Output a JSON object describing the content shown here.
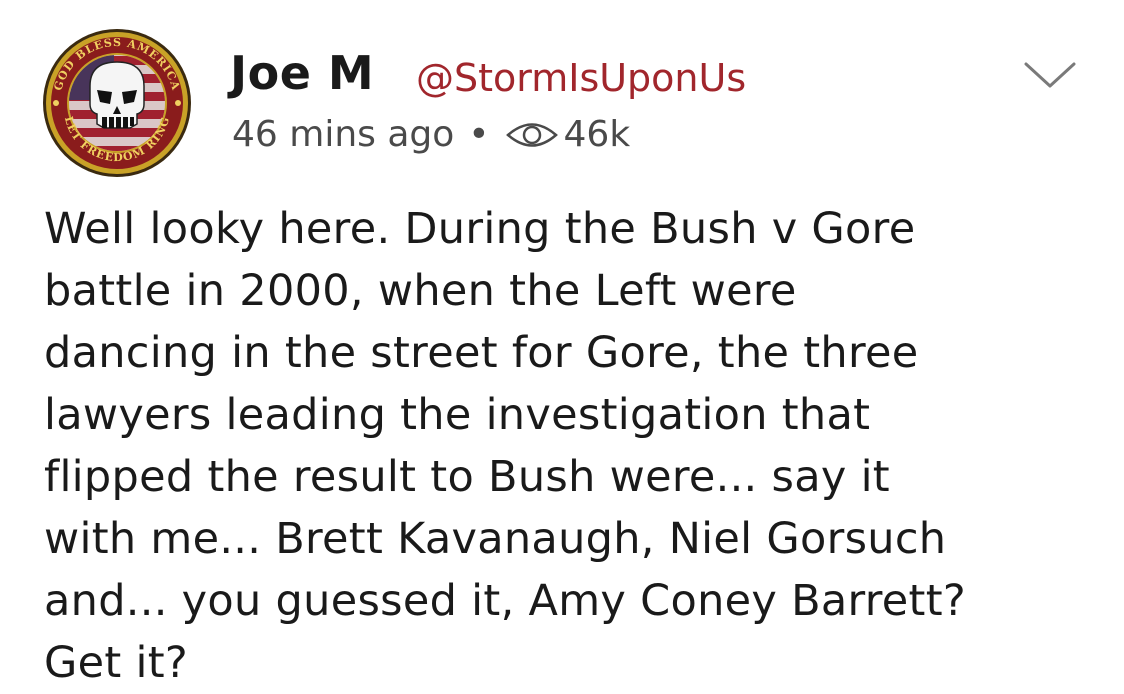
{
  "author": {
    "name": "Joe M",
    "handle": "@StormIsUponUs",
    "avatar": {
      "ring_text_top": "GOD BLESS AMERICA",
      "ring_text_bottom": "LET FREEDOM RING"
    }
  },
  "meta": {
    "time_ago": "46 mins ago",
    "separator": "•",
    "view_count": "46k"
  },
  "post": {
    "lines": [
      "Well looky here. During the Bush v Gore",
      "battle in 2000, when the Left were",
      "dancing in the street for Gore, the three",
      "lawyers leading the investigation that",
      "flipped the result to Bush were... say it",
      "with me... Brett Kavanaugh, Niel Gorsuch",
      "and... you guessed it, Amy Coney Barrett?",
      "Get it?"
    ]
  },
  "icons": {
    "menu": "chevron-down-icon",
    "views": "eye-icon"
  },
  "colors": {
    "handle": "#a1262c",
    "text": "#1a1a1a",
    "meta": "#4a4a4a",
    "avatar_ring": "#c9a227"
  }
}
